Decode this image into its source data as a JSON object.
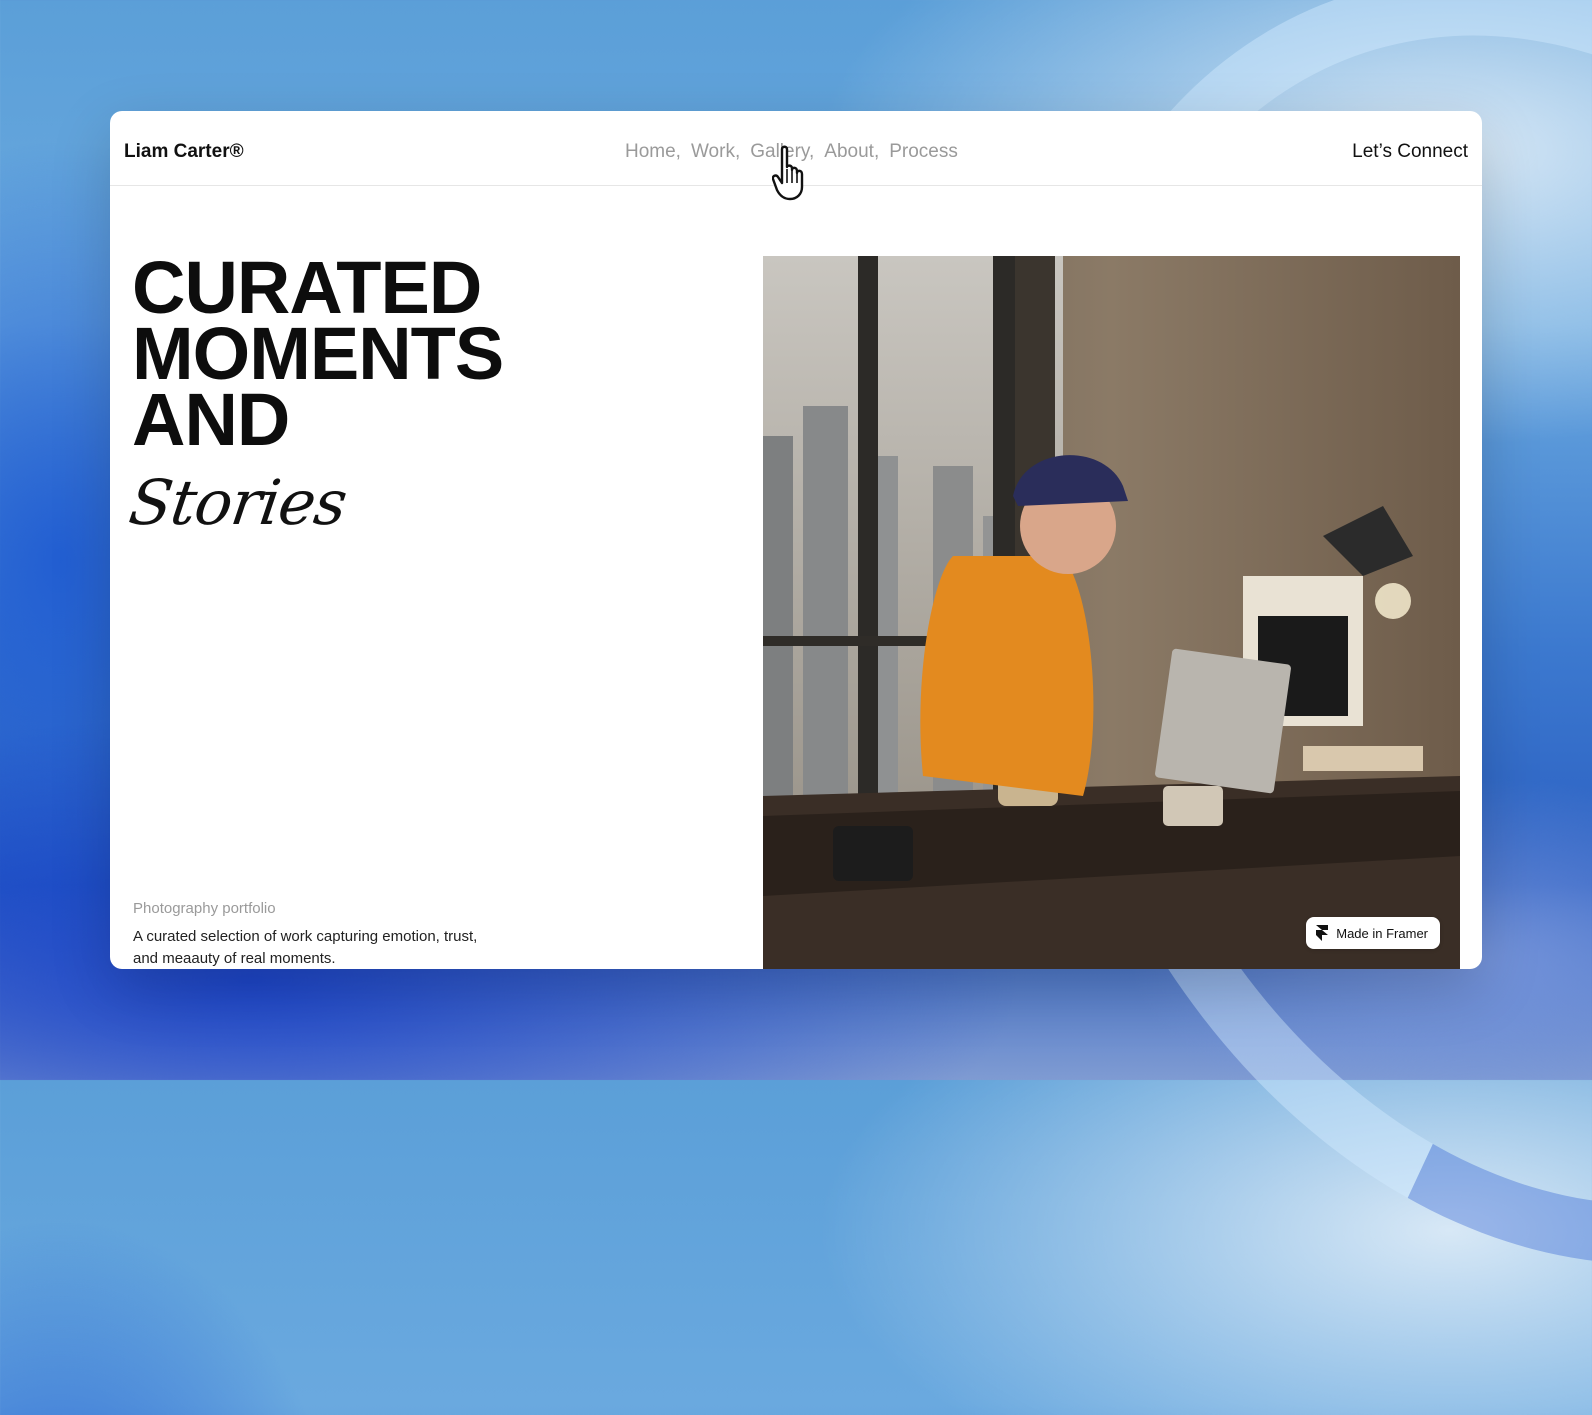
{
  "brand": "Liam Carter®",
  "nav": {
    "items": [
      "Home,",
      "Work,",
      "Gallery,",
      "About,",
      "Process"
    ],
    "cta": "Let’s Connect"
  },
  "hero": {
    "title_lines": [
      "CURATED",
      "MOMENTS",
      "AND"
    ],
    "script": "Stories",
    "eyebrow": "Photography portfolio",
    "description": "A curated selection of work capturing emotion, trust, and meaauty of real moments."
  },
  "badge": {
    "label": "Made in Framer",
    "icon": "framer-icon"
  },
  "photo": {
    "icon": "hero-photo"
  },
  "cursor": {
    "icon": "hand-pointer-icon"
  }
}
